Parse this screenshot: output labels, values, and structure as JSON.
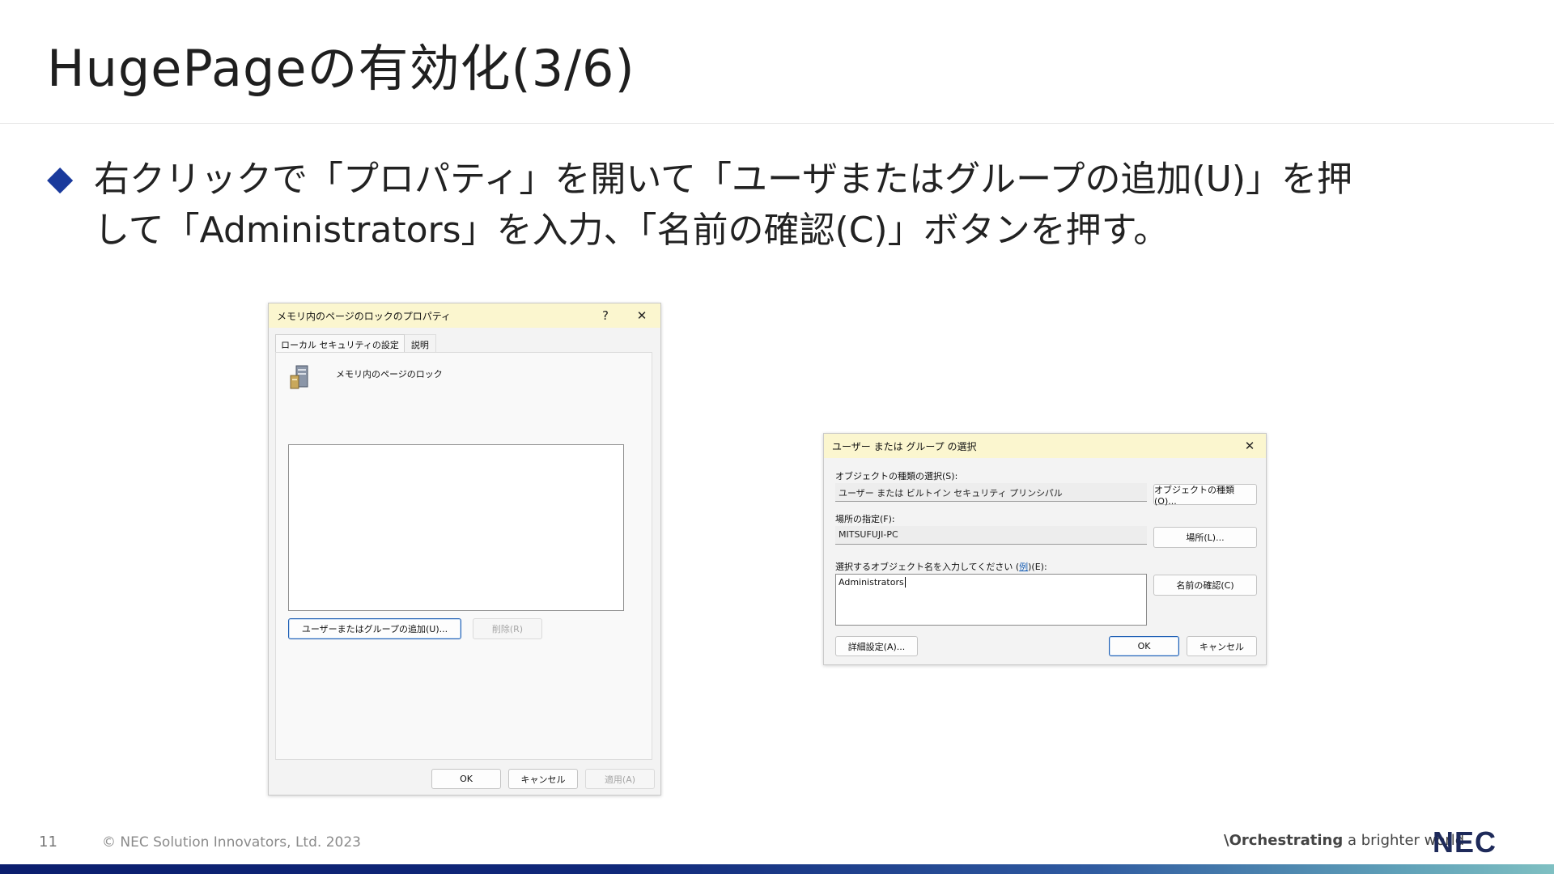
{
  "slide": {
    "title": "HugePageの有効化(3/6)",
    "bullet_mark": "◆",
    "bullet_line1": "右クリックで「プロパティ」を開いて「ユーザまたはグループの追加(U)」を押",
    "bullet_line2": "して「Administrators」を入力、「名前の確認(C)」ボタンを押す。"
  },
  "properties_dialog": {
    "title": "メモリ内のページのロックのプロパティ",
    "help": "?",
    "close": "✕",
    "tabs": [
      "ローカル セキュリティの設定",
      "説明"
    ],
    "policy_name": "メモリ内のページのロック",
    "add_button": "ユーザーまたはグループの追加(U)...",
    "remove_button": "削除(R)",
    "ok": "OK",
    "cancel": "キャンセル",
    "apply": "適用(A)"
  },
  "select_dialog": {
    "title": "ユーザー または グループ の選択",
    "close": "✕",
    "object_type_label": "オブジェクトの種類の選択(S):",
    "object_type_value": "ユーザー または ビルトイン セキュリティ プリンシパル",
    "object_type_button": "オブジェクトの種類(O)...",
    "location_label": "場所の指定(F):",
    "location_value": "MITSUFUJI-PC",
    "location_button": "場所(L)...",
    "enter_label_pre": "選択するオブジェクト名を入力してください (",
    "enter_label_link": "例",
    "enter_label_post": ")(E):",
    "object_names": "Administrators",
    "check_names_button": "名前の確認(C)",
    "advanced_button": "詳細設定(A)...",
    "ok": "OK",
    "cancel": "キャンセル"
  },
  "footer": {
    "page_number": "11",
    "copyright": "© NEC Solution Innovators, Ltd. 2023",
    "tagline_strong": "\\Orchestrating",
    "tagline_rest": " a brighter world",
    "logo": "NEC"
  },
  "colors": {
    "accent": "#1a3a9c",
    "dialog_title": "#fbf6cf",
    "bar_start": "#0b1e6e",
    "bar_end": "#7fc0c2"
  }
}
